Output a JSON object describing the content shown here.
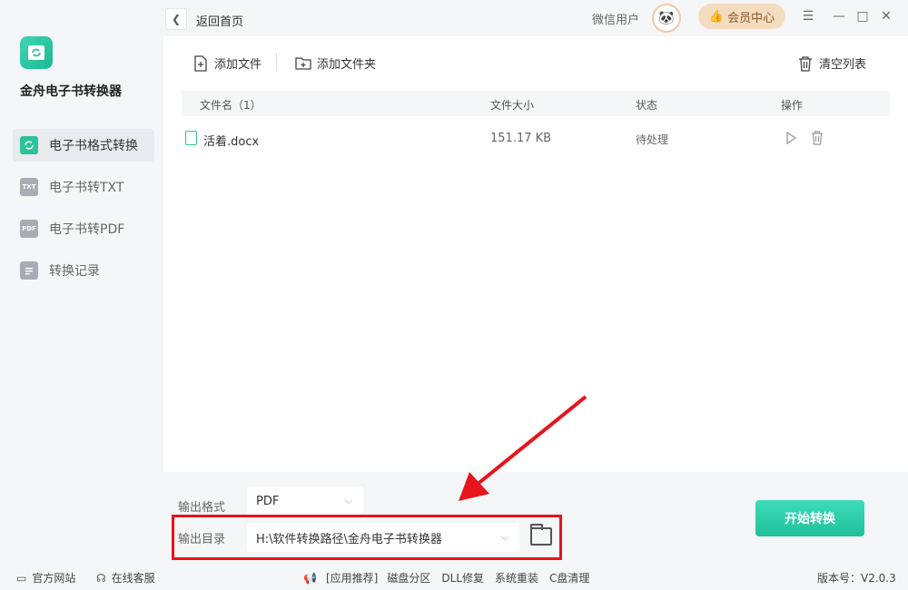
{
  "app": {
    "name": "金舟电子书转换器",
    "version": "版本号：V2.0.3"
  },
  "titlebar": {
    "back_label": "返回首页",
    "user_name": "微信用户",
    "vip_label": "会员中心"
  },
  "sidebar": {
    "items": [
      {
        "label": "电子书格式转换",
        "icon": "refresh-icon",
        "badge": "",
        "active": true
      },
      {
        "label": "电子书转TXT",
        "icon": "txt-icon",
        "badge": "TXT",
        "active": false
      },
      {
        "label": "电子书转PDF",
        "icon": "pdf-icon",
        "badge": "PDF",
        "active": false
      },
      {
        "label": "转换记录",
        "icon": "list-icon",
        "badge": "",
        "active": false
      }
    ]
  },
  "toolbar": {
    "add_file": "添加文件",
    "add_folder": "添加文件夹",
    "clear_list": "清空列表"
  },
  "table": {
    "headers": {
      "name": "文件名（1）",
      "size": "文件大小",
      "status": "状态",
      "actions": "操作"
    },
    "rows": [
      {
        "name": "活着.docx",
        "size": "151.17 KB",
        "status": "待处理"
      }
    ]
  },
  "config": {
    "format_label": "输出格式",
    "format_value": "PDF",
    "dir_label": "输出目录",
    "dir_value": "H:\\软件转换路径\\金舟电子书转换器",
    "start_label": "开始转换"
  },
  "statusbar": {
    "website": "官方网站",
    "support": "在线客服",
    "links": [
      "[应用推荐]",
      "磁盘分区",
      "DLL修复",
      "系统重装",
      "C盘清理"
    ]
  },
  "colors": {
    "accent": "#2cc39c",
    "highlight": "#e8131b",
    "vip": "#f3dcbf"
  }
}
